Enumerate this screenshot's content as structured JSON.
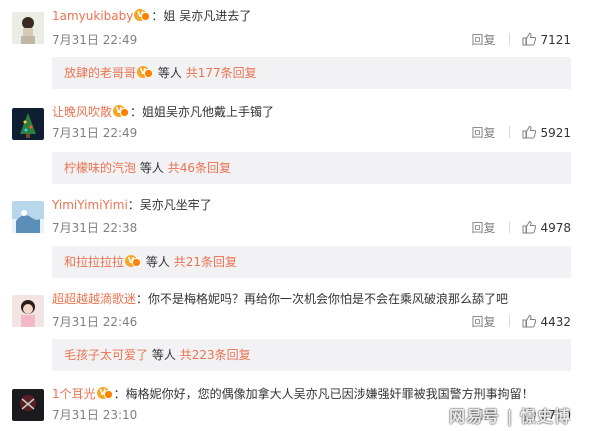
{
  "ui": {
    "reply_label": "回复",
    "suffix_people": "等人",
    "colors": {
      "username": "#eb7350",
      "meta": "#808080",
      "subbox_bg": "#f2f2f5"
    },
    "icons": [
      "vip-badge-icon",
      "thumbs-up-icon"
    ]
  },
  "comments": [
    {
      "username": "1amyukibaby",
      "colon": "：",
      "text": "姐 吴亦凡进去了",
      "time": "7月31日 22:49",
      "likes": "7121",
      "sub": {
        "user": "放肆的老哥哥",
        "count": "共177条回复"
      }
    },
    {
      "username": "让晚风吹散",
      "colon": "：",
      "text": "姐姐吴亦凡他戴上手镯了",
      "time": "7月31日 22:49",
      "likes": "5921",
      "sub": {
        "user": "柠檬味的汽泡",
        "count": "共46条回复"
      }
    },
    {
      "username": "YimiYimiYimi",
      "colon": "：",
      "text": "吴亦凡坐牢了",
      "time": "7月31日 22:38",
      "likes": "4978",
      "sub": {
        "user": "和拉拉拉拉",
        "count": "共21条回复"
      }
    },
    {
      "username": "超超越越滴歌迷",
      "colon": "：",
      "text": "你不是梅格妮吗？再给你一次机会你怕是不会在乘风破浪那么舔了吧",
      "time": "7月31日 22:46",
      "likes": "4432",
      "sub": {
        "user": "毛孩子太可爱了",
        "count": "共223条回复"
      }
    },
    {
      "username": "1个耳光",
      "colon": "：",
      "text": "梅格妮你好，您的偶像加拿大人吴亦凡已因涉嫌强奸罪被我国警方刑事拘留！",
      "time": "7月31日 23:10",
      "likes": "3700"
    }
  ],
  "watermark": "网易号 | 憬史博"
}
